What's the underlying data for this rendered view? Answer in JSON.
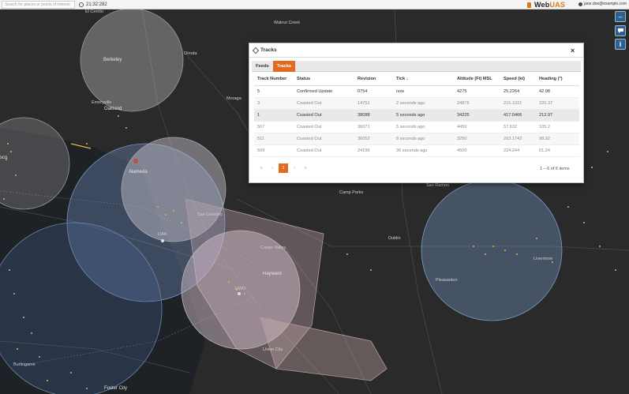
{
  "topbar": {
    "search_placeholder": "Search for places or points of interest",
    "clock": "21:32:282",
    "brand_prefix": "Web",
    "brand_suffix": "UAS",
    "user": "jane.doe@example.com"
  },
  "map": {
    "labels": {
      "el_cerrito": "El Cerrito",
      "berkeley": "Berkeley",
      "walnut_creek": "Walnut Creek",
      "orinda": "Orinda",
      "moraga": "Moraga",
      "emeryville": "Emeryville",
      "oakland": "Oakland",
      "alameda": "Alameda",
      "san_leandro": "San Leandro",
      "san_ramon": "San Ramon",
      "dublin": "Dublin",
      "castro_valley": "Castro Valley",
      "hayward": "Hayward",
      "livermore": "Livermore",
      "pleasanton": "Pleasanton",
      "union_city": "Union City",
      "burlingame": "Burlingame",
      "foster_city": "Foster City",
      "sf_fragment": "sco",
      "oak_marker": "OAK",
      "hwd_marker": "HWD",
      "camp_parks": "Camp Parks"
    }
  },
  "side_controls": {
    "collapse": "–",
    "chat_icon": "speech-bubble-icon",
    "info": "i"
  },
  "dialog": {
    "title": "Tracks",
    "close": "×",
    "tabs": [
      "Feeds",
      "Tracks"
    ],
    "active_tab": "Tracks",
    "columns": [
      "Track Number",
      "Status",
      "Revision",
      "Tick ↓",
      "Altitude (Ft) MSL",
      "Speed (kt)",
      "Heading (°)"
    ],
    "rows": [
      {
        "track": "5",
        "status": "Confirmed Update",
        "revision": "0754",
        "tick": "now",
        "altitude": "4275",
        "speed": "25.2264",
        "heading": "42.98"
      },
      {
        "track": "3",
        "status": "Coasted Out",
        "revision": "14751",
        "tick": "2 seconds ago",
        "altitude": "24875",
        "speed": "215.1021",
        "heading": "220.37"
      },
      {
        "track": "1",
        "status": "Coasted Out",
        "revision": "38088",
        "tick": "5 seconds ago",
        "altitude": "34225",
        "speed": "417.0466",
        "heading": "212.97"
      },
      {
        "track": "507",
        "status": "Coasted Out",
        "revision": "36071",
        "tick": "5 seconds ago",
        "altitude": "4450",
        "speed": "57.632",
        "heading": "105.2"
      },
      {
        "track": "511",
        "status": "Coasted Out",
        "revision": "36052",
        "tick": "8 seconds ago",
        "altitude": "3250",
        "speed": "263.1742",
        "heading": "98.92"
      },
      {
        "track": "509",
        "status": "Coasted Out",
        "revision": "24196",
        "tick": "36 seconds ago",
        "altitude": "4500",
        "speed": "224.244",
        "heading": "51.24"
      }
    ],
    "pager": {
      "first": "«",
      "prev": "‹",
      "page": "1",
      "next": "›",
      "last": "»"
    },
    "items_count": "1 – 6 of 6 items"
  }
}
